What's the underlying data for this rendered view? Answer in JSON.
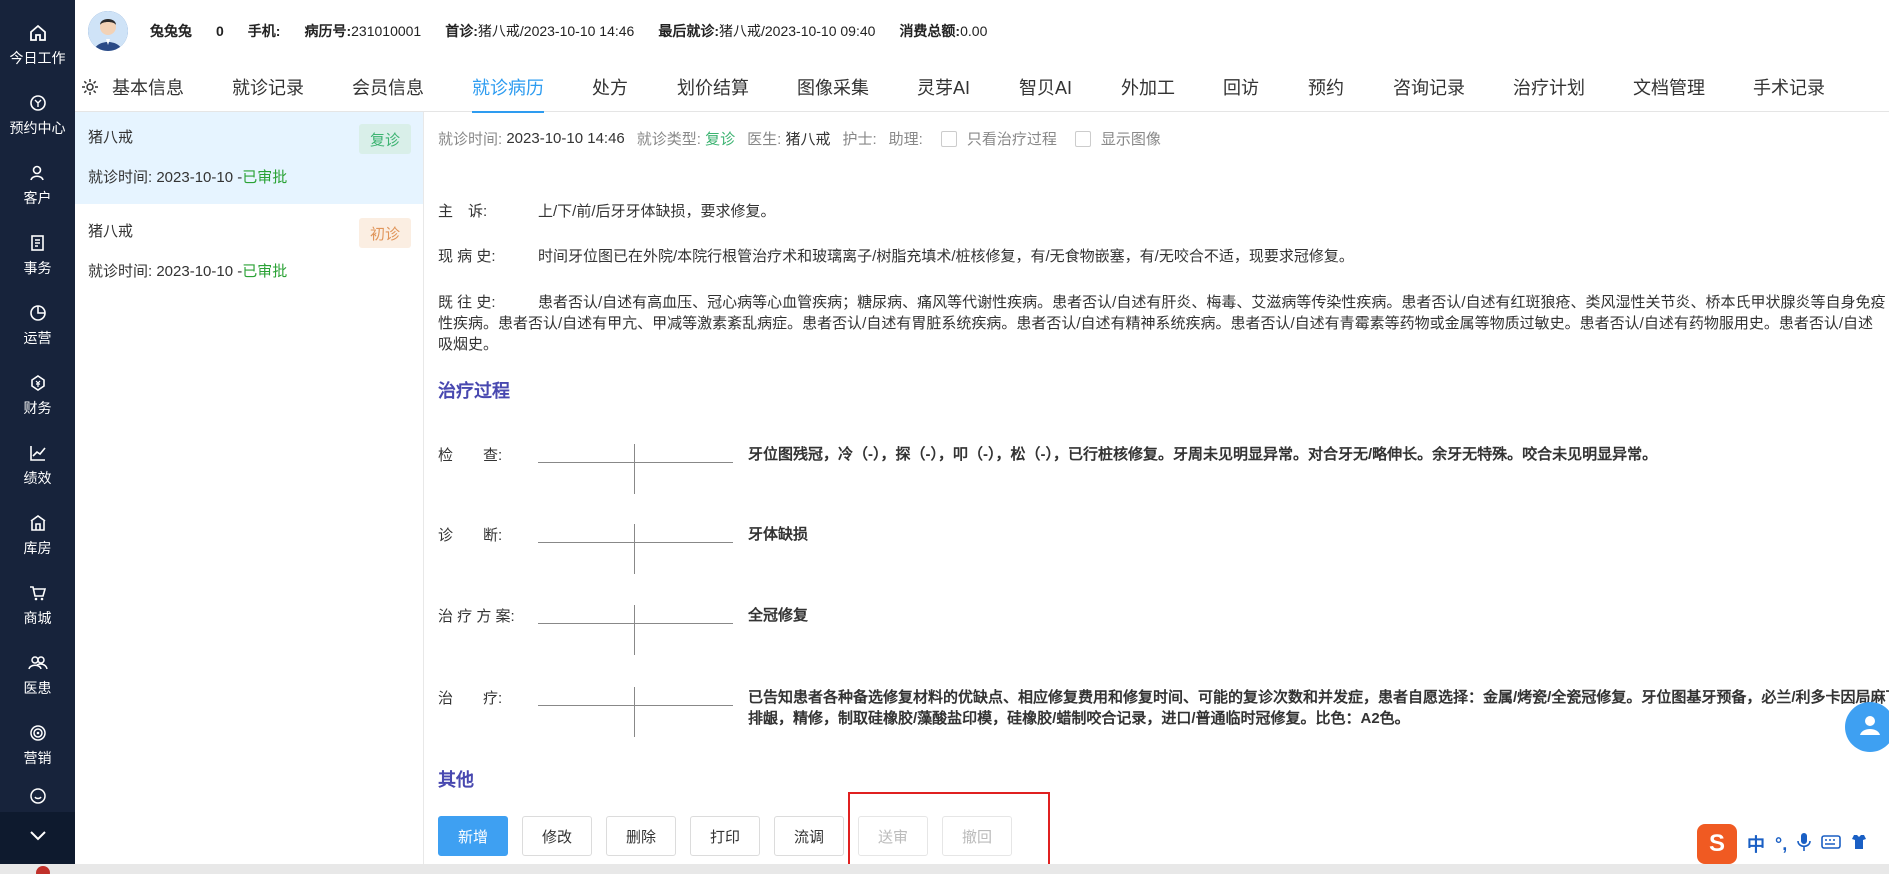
{
  "sidebar": {
    "items": [
      {
        "label": "今日工作",
        "icon": "home-icon"
      },
      {
        "label": "预约中心",
        "icon": "calendar-icon"
      },
      {
        "label": "客户",
        "icon": "user-icon"
      },
      {
        "label": "事务",
        "icon": "task-icon"
      },
      {
        "label": "运营",
        "icon": "pie-icon"
      },
      {
        "label": "财务",
        "icon": "money-icon"
      },
      {
        "label": "绩效",
        "icon": "chart-icon"
      },
      {
        "label": "库房",
        "icon": "warehouse-icon"
      },
      {
        "label": "商城",
        "icon": "cart-icon"
      },
      {
        "label": "医患",
        "icon": "people-icon"
      },
      {
        "label": "营销",
        "icon": "target-icon"
      }
    ]
  },
  "header": {
    "name": "兔兔兔",
    "count": "0",
    "phone_label": "手机:",
    "record_label": "病历号:",
    "record_no": "231010001",
    "first_visit_label": "首诊:",
    "first_visit": "猪八戒/2023-10-10 14:46",
    "last_visit_label": "最后就诊:",
    "last_visit": "猪八戒/2023-10-10 09:40",
    "total_label": "消费总额:",
    "total": "0.00"
  },
  "tabs": [
    "基本信息",
    "就诊记录",
    "会员信息",
    "就诊病历",
    "处方",
    "划价结算",
    "图像采集",
    "灵芽AI",
    "智贝AI",
    "外加工",
    "回访",
    "预约",
    "咨询记录",
    "治疗计划",
    "文档管理",
    "手术记录"
  ],
  "active_tab": "就诊病历",
  "visits": [
    {
      "doctor": "猪八戒",
      "type": "复诊",
      "time_label": "就诊时间:",
      "date": "2023-10-10",
      "sep": " -",
      "status": "已审批"
    },
    {
      "doctor": "猪八戒",
      "type": "初诊",
      "time_label": "就诊时间:",
      "date": "2023-10-10",
      "sep": " -",
      "status": "已审批"
    }
  ],
  "infobar": {
    "time_label": "就诊时间:",
    "time": "2023-10-10 14:46",
    "type_label": "就诊类型:",
    "type": "复诊",
    "doctor_label": "医生:",
    "doctor": "猪八戒",
    "nurse_label": "护士:",
    "assistant_label": "助理:",
    "only_treatment": "只看治疗过程",
    "show_images": "显示图像"
  },
  "record": {
    "complaint_label": "主　诉:",
    "complaint": "上/下/前/后牙牙体缺损，要求修复。",
    "present_label": "现 病 史:",
    "present": "时间牙位图已在外院/本院行根管治疗术和玻璃离子/树脂充填术/桩核修复，有/无食物嵌塞，有/无咬合不适，现要求冠修复。",
    "past_label": "既 往 史:",
    "past_line1": "患者否认/自述有高血压、冠心病等心血管疾病；糖尿病、痛风等代谢性疾病。患者否认/自述有肝炎、梅毒、艾滋病等传染性疾病。患者否认/自述有红斑狼疮、类风湿性关节炎、桥本氏甲状腺炎等自身免疫",
    "past_line2": "性疾病。患者否认/自述有甲亢、甲减等激素紊乱病症。患者否认/自述有胃脏系统疾病。患者否认/自述有精神系统疾病。患者否认/自述有青霉素等药物或金属等物质过敏史。患者否认/自述有药物服用史。患者否认/自述",
    "past_line3": "吸烟史。"
  },
  "treatment": {
    "title": "治疗过程",
    "rows": [
      {
        "label": "检　　查:",
        "text": "牙位图残冠，冷（-），探（-），叩（-），松（-），已行桩核修复。牙周未见明显异常。对合牙无/略伸长。余牙无特殊。咬合未见明显异常。",
        "text2": ""
      },
      {
        "label": "诊　　断:",
        "text": "牙体缺损",
        "text2": ""
      },
      {
        "label": "治 疗 方 案:",
        "text": "全冠修复",
        "text2": ""
      },
      {
        "label": "治　　疗:",
        "text": "已告知患者各种备选修复材料的优缺点、相应修复费用和修复时间、可能的复诊次数和并发症，患者自愿选择：金属/烤瓷/全瓷冠修复。牙位图基牙预备，必兰/利多卡因局麻下",
        "text2": "排龈，精修，制取硅橡胶/藻酸盐印模，硅橡胶/蜡制咬合记录，进口/普通临时冠修复。比色：A2色。"
      }
    ]
  },
  "other": {
    "title": "其他"
  },
  "buttons": {
    "add": "新增",
    "edit": "修改",
    "delete": "删除",
    "print": "打印",
    "transfer": "流调",
    "submit": "送审",
    "revoke": "撤回"
  },
  "ime": {
    "lang": "中",
    "punct": "°,"
  }
}
